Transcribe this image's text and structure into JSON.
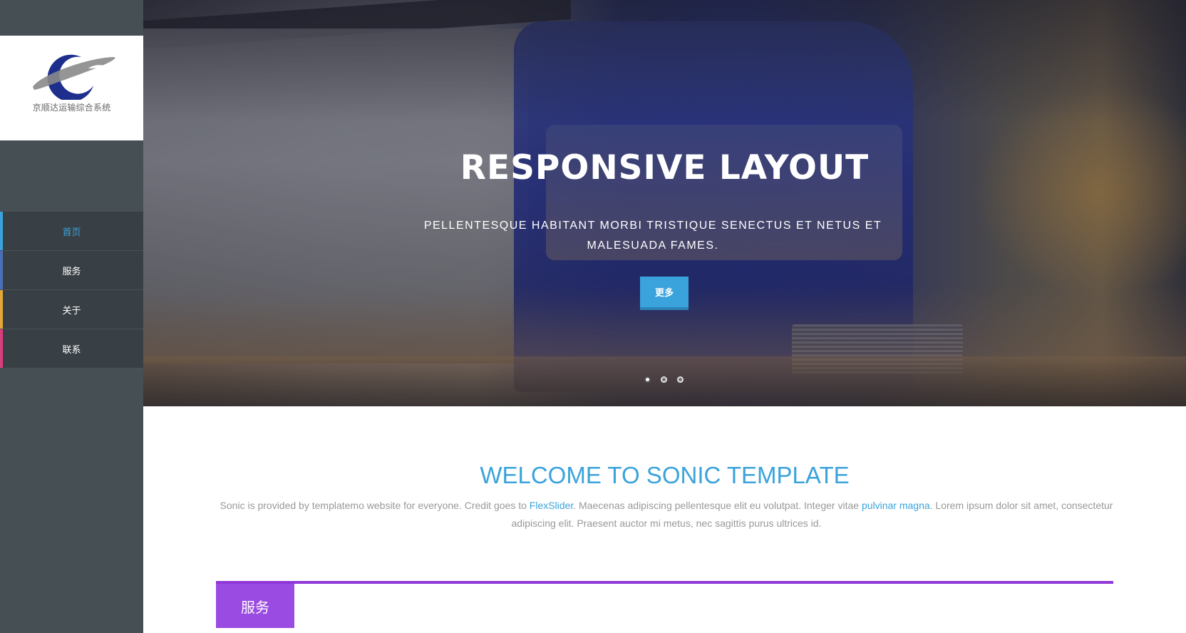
{
  "brand": {
    "logo_text": "京顺达运输综合系统",
    "logo_colors": {
      "arc": "#1d2e8c",
      "swoosh": "#8a8a8a"
    }
  },
  "nav": {
    "items": [
      {
        "label": "首页",
        "accent": "#3aa3dc",
        "active": true
      },
      {
        "label": "服务",
        "accent": "#4a6fb8",
        "active": false
      },
      {
        "label": "关于",
        "accent": "#e2a838",
        "active": false
      },
      {
        "label": "联系",
        "accent": "#d93d7e",
        "active": false
      }
    ]
  },
  "hero": {
    "title": "RESPONSIVE LAYOUT",
    "subtitle": "PELLENTESQUE HABITANT MORBI TRISTIQUE SENECTUS ET NETUS ET MALESUADA FAMES.",
    "button_label": "更多",
    "slides": 3,
    "active_slide": 1
  },
  "welcome": {
    "title": "WELCOME TO SONIC TEMPLATE",
    "text_1": "Sonic is provided by templatemo website for everyone. Credit goes to ",
    "link_1": "FlexSlider",
    "text_2": ". Maecenas adipiscing pellentesque elit eu volutpat. Integer vitae ",
    "link_2": "pulvinar magna",
    "text_3": ". Lorem ipsum dolor sit amet, consectetur adipiscing elit. Praesent auctor mi metus, nec sagittis purus ultrices id."
  },
  "services": {
    "tab_label": "服务",
    "accent": "#9a4be2"
  },
  "colors": {
    "sidebar": "#464f54",
    "nav_bg": "#394045",
    "primary": "#3aa3dc"
  }
}
